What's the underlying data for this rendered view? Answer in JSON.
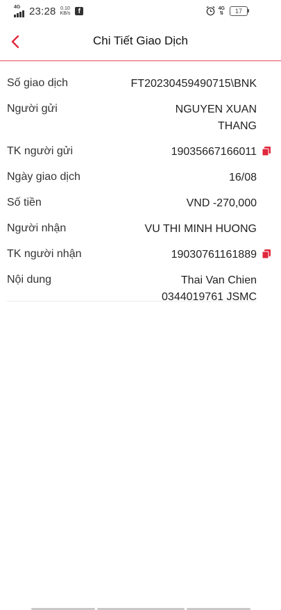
{
  "status_bar": {
    "network": "4G",
    "time": "23:28",
    "speed_value": "0.10",
    "speed_unit": "KB/s",
    "network_right": "4G",
    "battery": "17",
    "icons": [
      "signal-icon",
      "facebook-icon",
      "alarm-icon",
      "battery-icon"
    ]
  },
  "header": {
    "title": "Chi Tiết Giao Dịch",
    "back_icon": "chevron-left-icon",
    "accent_color": "#e0283c"
  },
  "details": {
    "transaction_id": {
      "label": "Số giao dịch",
      "value": "FT20230459490715\\BNK"
    },
    "sender_name": {
      "label": "Người gửi",
      "value_line1": "NGUYEN XUAN",
      "value_line2": "THANG"
    },
    "sender_account": {
      "label": "TK người gửi",
      "value": "19035667166011",
      "icon": "copy-icon"
    },
    "transaction_date": {
      "label": "Ngày giao dịch",
      "value": "16/08"
    },
    "amount": {
      "label": "Số tiền",
      "value": "VND -270,000"
    },
    "receiver_name": {
      "label": "Người nhận",
      "value": "VU THI MINH HUONG"
    },
    "receiver_account": {
      "label": "TK người nhận",
      "value": "19030761161889",
      "icon": "copy-icon"
    },
    "content": {
      "label": "Nội dung",
      "value_line1": "Thai Van Chien",
      "value_line2": "0344019761 JSMC"
    }
  }
}
